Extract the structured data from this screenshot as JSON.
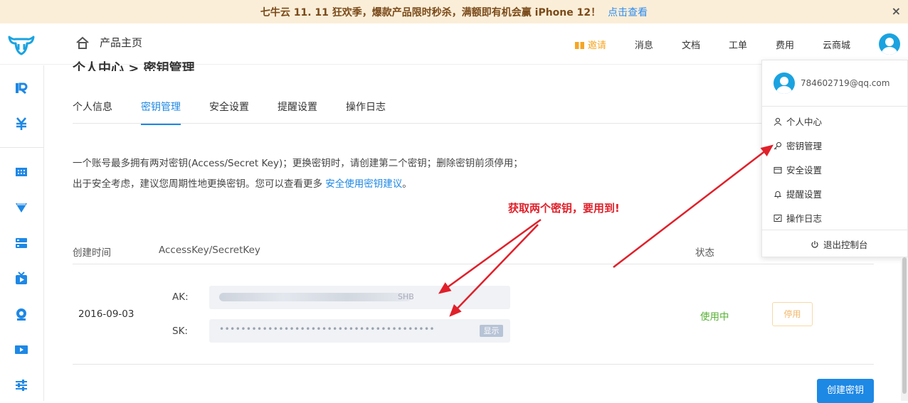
{
  "banner": {
    "text": "七牛云 11. 11 狂欢季，爆款产品限时秒杀，满额即有机会赢 iPhone 12！",
    "link": "点击查看",
    "close": "×"
  },
  "header": {
    "home_label": "产品主页",
    "nav": [
      "邀请",
      "消息",
      "文档",
      "工单",
      "费用",
      "云商城"
    ]
  },
  "breadcrumb_partial": "个人中心  >  密钥管理",
  "tabs": [
    "个人信息",
    "密钥管理",
    "安全设置",
    "提醒设置",
    "操作日志"
  ],
  "active_tab": "密钥管理",
  "description": {
    "text": "一个账号最多拥有两对密钥(Access/Secret Key)；更换密钥时，请创建第二个密钥；删除密钥前须停用；出于安全考虑，建议您周期性地更换密钥。您可以查看更多 ",
    "link": "安全使用密钥建议",
    "end": "。"
  },
  "annotation": "获取两个密钥，要用到!",
  "table": {
    "headers": {
      "created": "创建时间",
      "keys": "AccessKey/SecretKey",
      "status": "状态"
    },
    "row": {
      "date": "2016-09-03",
      "ak_label": "AK:",
      "ak_tail": "SHB",
      "sk_label": "SK:",
      "sk_mask": "••••••••••••••••••••••••••••••••••••••••",
      "show_button": "显示",
      "status": "使用中",
      "disable_button": "停用"
    }
  },
  "create_button": "创建密钥",
  "dropdown": {
    "email": "784602719@qq.com",
    "items": [
      "个人中心",
      "密钥管理",
      "安全设置",
      "提醒设置",
      "操作日志"
    ],
    "logout": "退出控制台"
  },
  "colors": {
    "accent": "#1e88e5",
    "banner_bg": "#fbeed8",
    "annotation": "#e0202a",
    "status_active": "#58b135",
    "invite": "#f5a623"
  }
}
